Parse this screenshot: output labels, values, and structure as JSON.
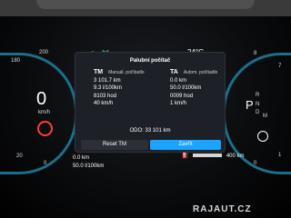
{
  "top": {
    "temp": "24°C",
    "icon_left": "lamp-indicator",
    "icon_mid": "lane-assist"
  },
  "left_gauge": {
    "speed": "0",
    "speed_unit": "km/h",
    "scale_180": "180",
    "scale_200": "200",
    "scale_20": "20",
    "scale_0": "0"
  },
  "right_gauge": {
    "scale_8": "8",
    "scale_7": "7",
    "scale_1": "1",
    "scale_0": "0",
    "gear_p": "P",
    "gear_r": "R",
    "gear_n": "N",
    "gear_d": "D",
    "gear_m": "M"
  },
  "panel": {
    "title": "Palubní počítač",
    "tm": {
      "head": "TM",
      "sub": "Manuál. počítadlo",
      "r1": "3 101.7 km",
      "r2": "9.3 l/100km",
      "r3": "8103 hod",
      "r4": "40 km/h"
    },
    "ta": {
      "head": "TA",
      "sub": "Autom. počítadlo",
      "r1": "0.0 km",
      "r2": "50.0 l/100km",
      "r3": "0009 hod",
      "r4": "1 km/h"
    },
    "odo": "ODO:  33 101 km",
    "reset": "Reset TM",
    "close": "Zavřít"
  },
  "bottom": {
    "line1": "0.0 km",
    "line2": "50.0 l/100km",
    "range": "400 km"
  },
  "watermark": "RAJAUT.CZ",
  "colors": {
    "accent": "#1aa3ff",
    "gauge": "#1b6f8a",
    "green": "#34d36e",
    "red": "#ff3b3b"
  }
}
